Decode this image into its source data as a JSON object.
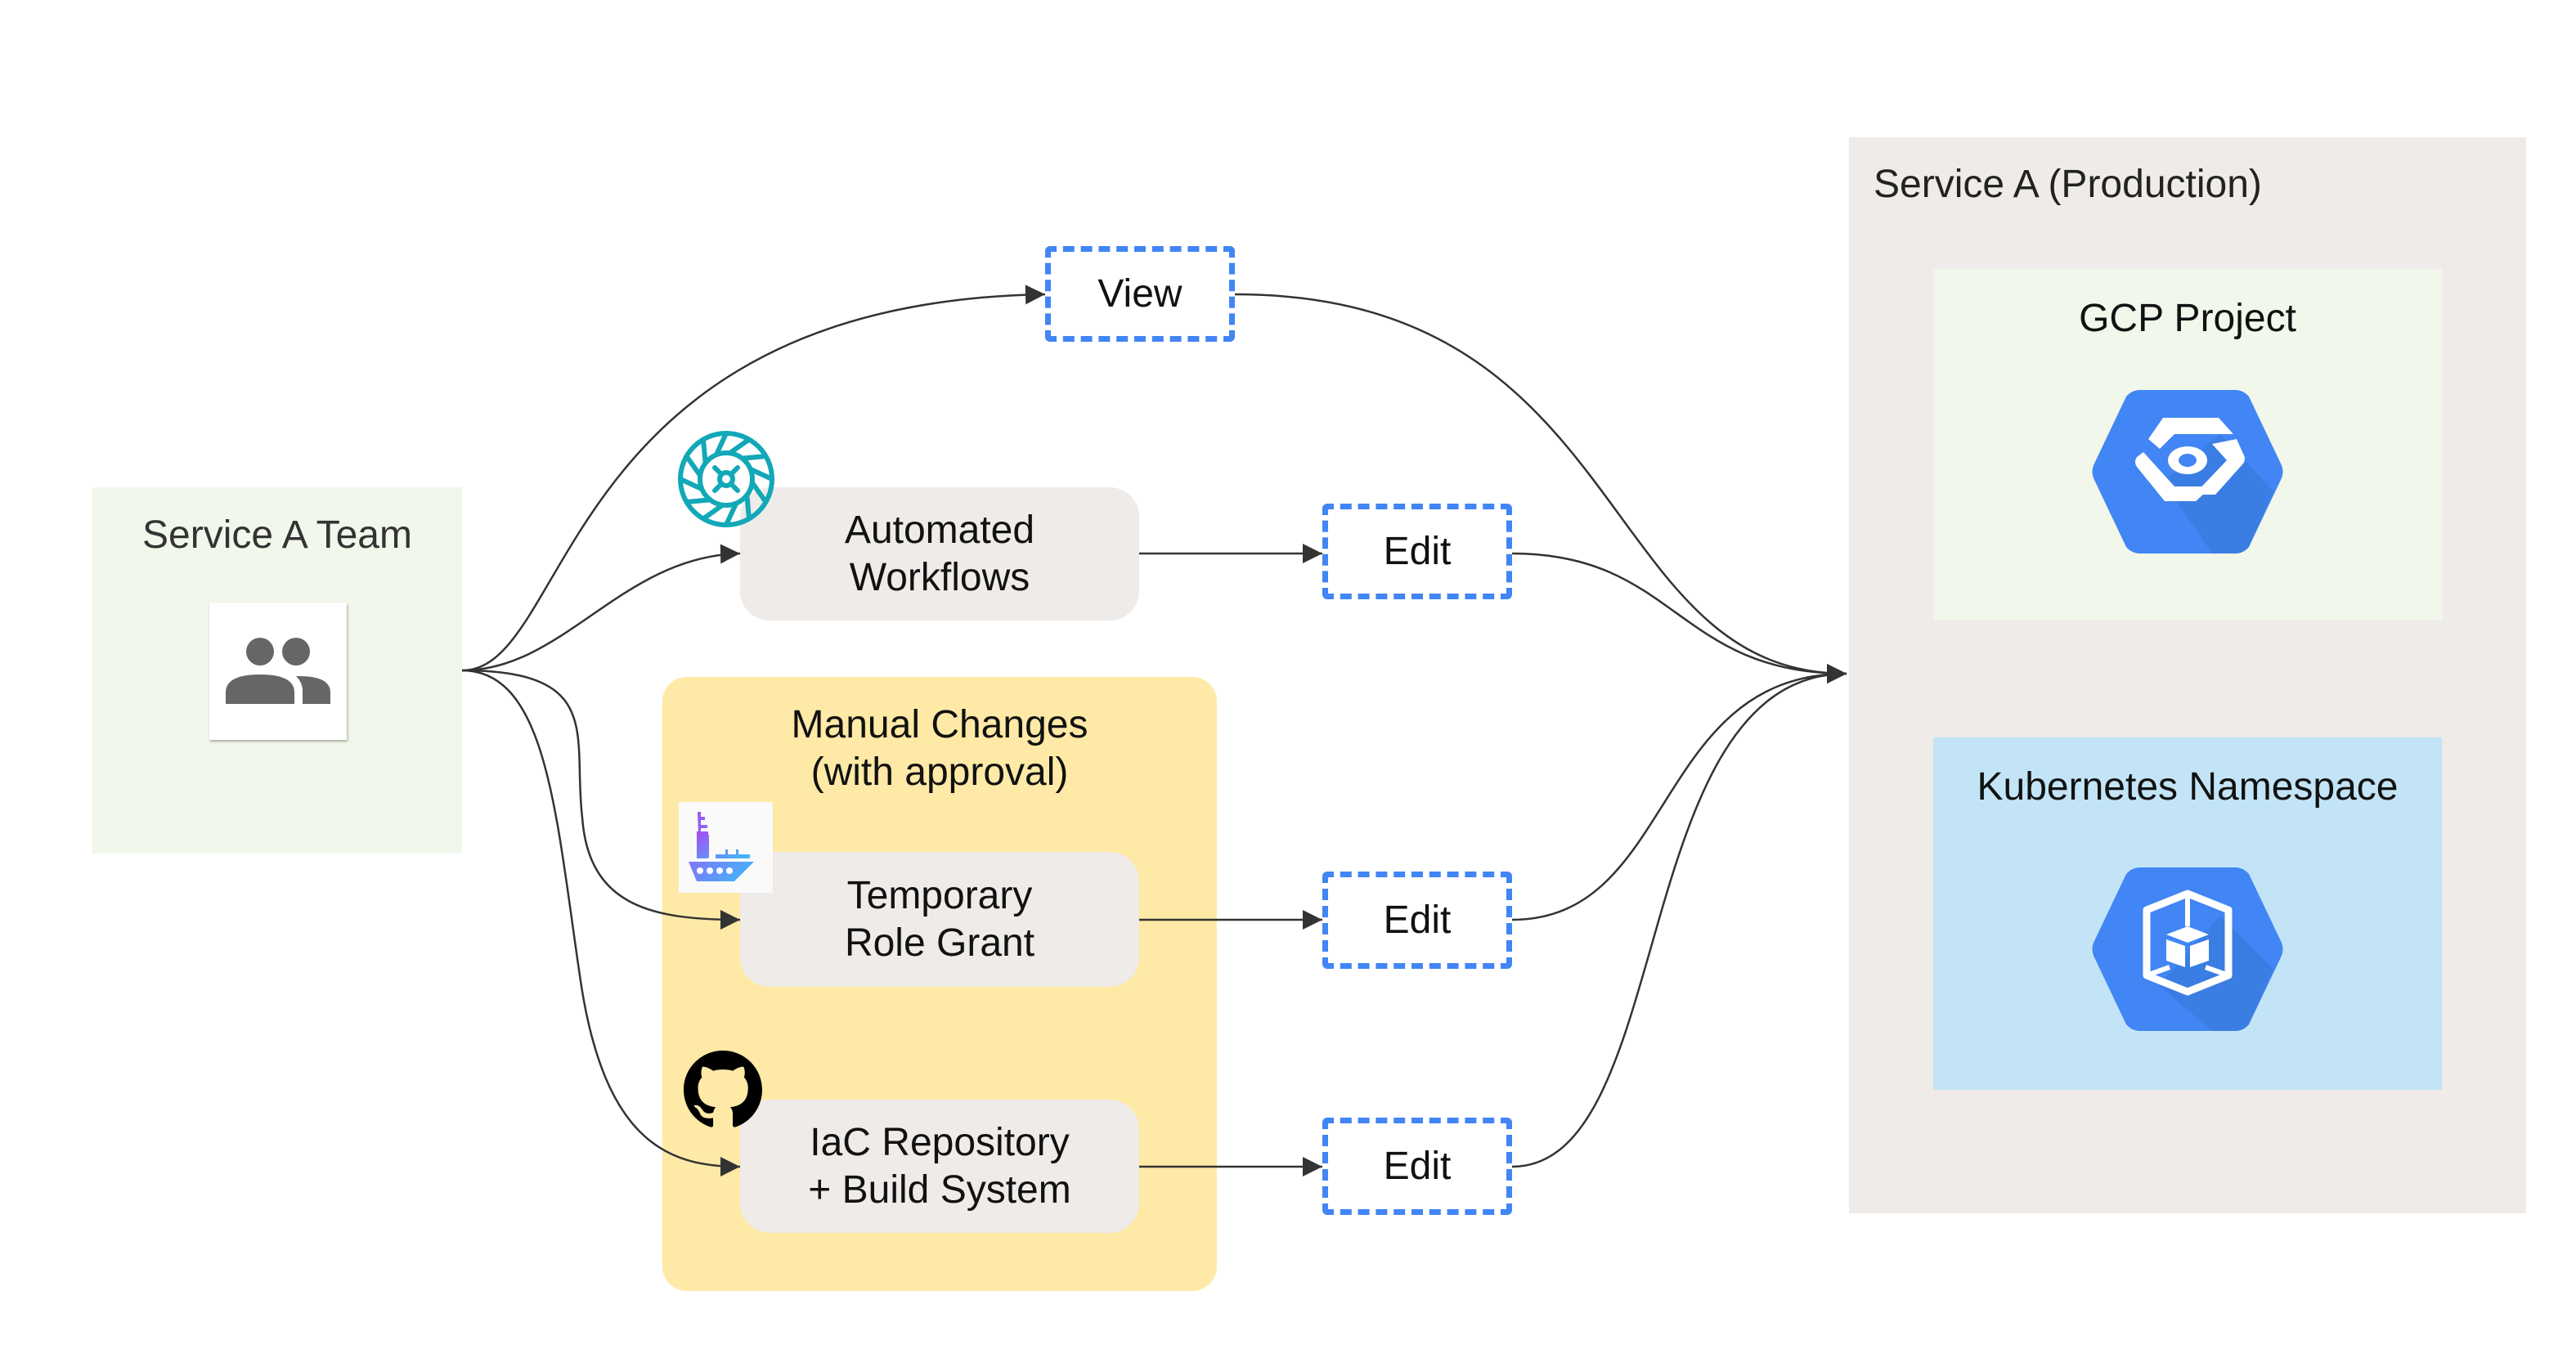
{
  "team": {
    "title": "Service A Team",
    "icon": "people-group-icon"
  },
  "access": {
    "view": "View",
    "edit_automated": "Edit",
    "edit_temporary": "Edit",
    "edit_iac": "Edit"
  },
  "paths": {
    "automated": {
      "line1": "Automated",
      "line2": "Workflows",
      "icon": "workflow-wheel-icon"
    },
    "manual_group": {
      "line1": "Manual Changes",
      "line2": "(with approval)"
    },
    "temporary": {
      "line1": "Temporary",
      "line2": "Role Grant",
      "icon": "ship-icon"
    },
    "iac": {
      "line1": "IaC Repository",
      "line2": "+ Build System",
      "icon": "github-icon"
    }
  },
  "production": {
    "title": "Service A (Production)",
    "gcp": {
      "title": "GCP Project",
      "icon": "gcp-project-hex-icon"
    },
    "k8s": {
      "title": "Kubernetes Namespace",
      "icon": "kubernetes-namespace-hex-icon"
    }
  },
  "colors": {
    "dashed_border": "#4285f4",
    "team_bg": "#f1f7ea",
    "manual_bg": "#fee9a6",
    "box_bg": "#eeebe8",
    "k8s_bg": "#c2e4f6",
    "hex_blue": "#4285f4",
    "teal": "#12a8b8"
  }
}
